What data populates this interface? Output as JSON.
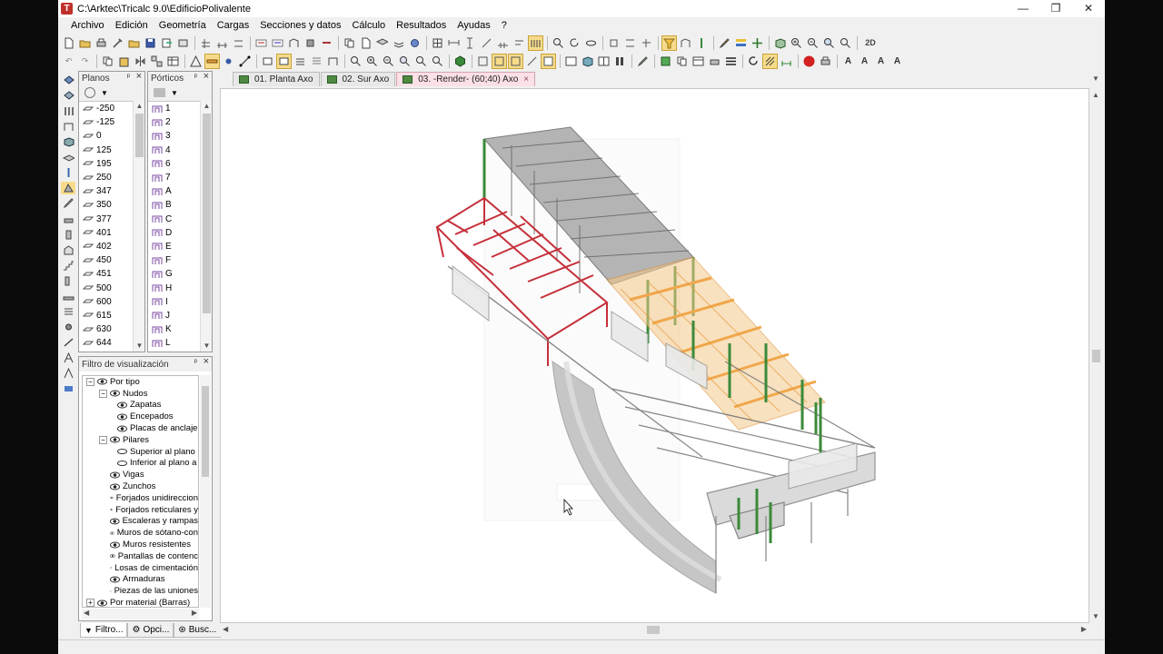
{
  "window": {
    "title": "C:\\Arktec\\Tricalc 9.0\\EdificioPolivalente",
    "app_icon_letter": "T",
    "minimize": "—",
    "restore": "❐",
    "close": "✕"
  },
  "menu": [
    "Archivo",
    "Edición",
    "Geometría",
    "Cargas",
    "Secciones y datos",
    "Cálculo",
    "Resultados",
    "Ayudas",
    "?"
  ],
  "toolbar": {
    "zoom_2d_label": "2D",
    "text_a_labels": [
      "A",
      "A",
      "A",
      "A"
    ],
    "stop_label": "STOP"
  },
  "planos": {
    "title": "Planos",
    "items": [
      "-250",
      "-125",
      "0",
      "125",
      "195",
      "250",
      "347",
      "350",
      "377",
      "401",
      "402",
      "450",
      "451",
      "500",
      "600",
      "615",
      "630",
      "644"
    ]
  },
  "porticos": {
    "title": "Pórticos",
    "items": [
      "1",
      "2",
      "3",
      "4",
      "6",
      "7",
      "A",
      "B",
      "C",
      "D",
      "E",
      "F",
      "G",
      "H",
      "I",
      "J",
      "K",
      "L"
    ]
  },
  "filtro": {
    "title": "Filtro de visualización",
    "tree": [
      {
        "label": "Por tipo",
        "level": 0,
        "exp": "−"
      },
      {
        "label": "Nudos",
        "level": 1,
        "exp": "−"
      },
      {
        "label": "Zapatas",
        "level": 2
      },
      {
        "label": "Encepados",
        "level": 2
      },
      {
        "label": "Placas de anclaje",
        "level": 2
      },
      {
        "label": "Pilares",
        "level": 1,
        "exp": "−"
      },
      {
        "label": "Superior al plano",
        "level": 2,
        "alt": true
      },
      {
        "label": "Inferior al plano a",
        "level": 2,
        "alt": true
      },
      {
        "label": "Vigas",
        "level": 1
      },
      {
        "label": "Zunchos",
        "level": 1
      },
      {
        "label": "Forjados unidireccion",
        "level": 1
      },
      {
        "label": "Forjados reticulares y",
        "level": 1
      },
      {
        "label": "Escaleras y rampas",
        "level": 1
      },
      {
        "label": "Muros de sótano-con",
        "level": 1
      },
      {
        "label": "Muros resistentes",
        "level": 1
      },
      {
        "label": "Pantallas de contenc",
        "level": 1
      },
      {
        "label": "Losas de cimentación",
        "level": 1
      },
      {
        "label": "Armaduras",
        "level": 1
      },
      {
        "label": "Piezas de las uniones",
        "level": 1
      },
      {
        "label": "Por material (Barras)",
        "level": 0,
        "exp": "+"
      }
    ]
  },
  "bottom_tabs": [
    "Filtro...",
    "Opci...",
    "Busc..."
  ],
  "doc_tabs": [
    {
      "label": "01. Planta   Axo",
      "active": false
    },
    {
      "label": "02. Sur   Axo",
      "active": false
    },
    {
      "label": "03. -Render-  (60;40)  Axo",
      "active": true
    }
  ],
  "colors": {
    "active_tab": "#fbe0e6",
    "red_frames": "#c5303a",
    "orange_slab": "#f0a64a",
    "green_columns": "#3a8a3a"
  }
}
